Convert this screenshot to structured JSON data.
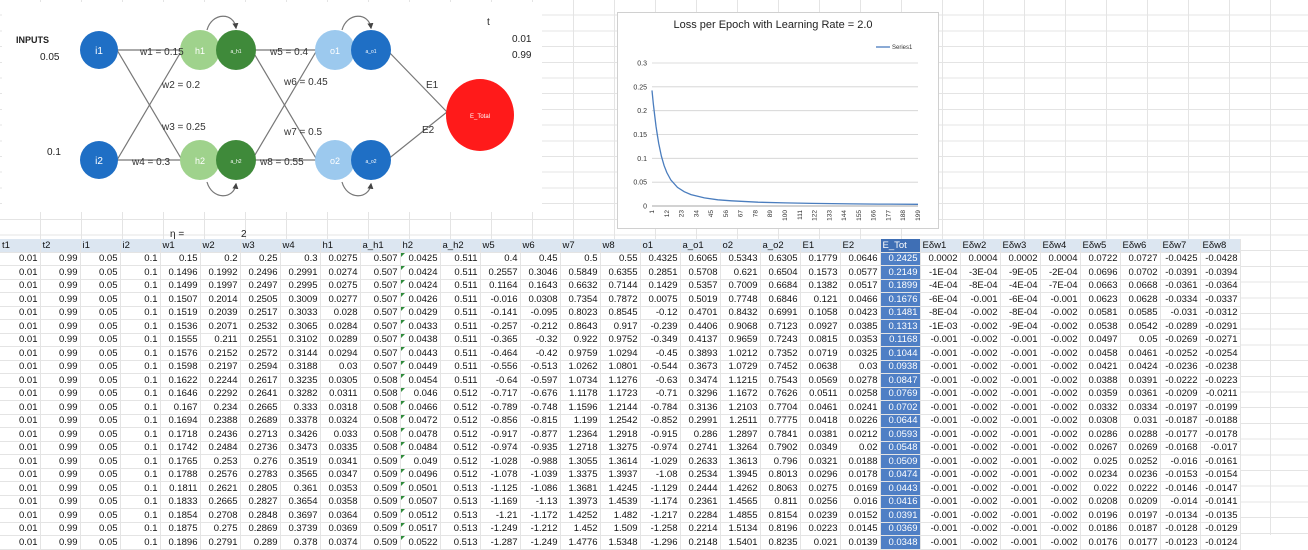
{
  "diagram": {
    "inputs_label": "INPUTS",
    "input1_value": "0.05",
    "input2_value": "0.1",
    "t_label": "t",
    "t1_value": "0.01",
    "t2_value": "0.99",
    "node_i1": "i1",
    "node_i2": "i2",
    "node_h1": "h1",
    "node_h2": "h2",
    "node_o1": "o1",
    "node_o2": "o2",
    "node_ah1": "a_h1",
    "node_ah2": "a_h2",
    "node_ao1": "a_o1",
    "node_ao2": "a_o2",
    "node_etotal": "E_Total",
    "w1": "w1 = 0.15",
    "w2": "w2 = 0.2",
    "w3": "w3 = 0.25",
    "w4": "w4 = 0.3",
    "w5": "w5 = 0.4",
    "w6": "w6 = 0.45",
    "w7": "w7 = 0.5",
    "w8": "w8 = 0.55",
    "e1": "E1",
    "e2": "E2",
    "colors": {
      "input": "#1f6fc5",
      "hidden_light": "#9fd28c",
      "hidden_dark": "#3f8a3a",
      "out_light": "#9cc9ee",
      "out_dark": "#1f6fc5",
      "etotal": "#ff1a1a"
    }
  },
  "eta": {
    "label": "η =",
    "value": "2"
  },
  "chart_data": {
    "type": "line",
    "title": "Loss per Epoch with Learning Rate = 2.0",
    "legend": [
      "Series1"
    ],
    "legend_position": "top-right",
    "ylim": [
      0,
      0.3
    ],
    "yticks": [
      "0",
      "0.05",
      "0.1",
      "0.15",
      "0.2",
      "0.25",
      "0.3"
    ],
    "xticks": [
      "1",
      "12",
      "23",
      "34",
      "45",
      "56",
      "67",
      "78",
      "89",
      "100",
      "111",
      "122",
      "133",
      "144",
      "155",
      "166",
      "177",
      "188",
      "199"
    ],
    "series": [
      {
        "name": "Series1",
        "x": [
          1,
          2,
          3,
          4,
          5,
          6,
          8,
          10,
          12,
          15,
          20,
          25,
          30,
          40,
          50,
          60,
          80,
          100,
          120,
          150,
          170,
          199
        ],
        "values": [
          0.2425,
          0.2149,
          0.1899,
          0.1676,
          0.1481,
          0.1313,
          0.1044,
          0.0847,
          0.0702,
          0.0548,
          0.0391,
          0.03,
          0.024,
          0.017,
          0.013,
          0.011,
          0.008,
          0.0065,
          0.0055,
          0.0045,
          0.004,
          0.0035
        ]
      }
    ],
    "grid": true,
    "color": "#4a7dbe"
  },
  "table": {
    "headers": [
      "t1",
      "t2",
      "i1",
      "i2",
      "w1",
      "w2",
      "w3",
      "w4",
      "h1",
      "a_h1",
      "h2",
      "a_h2",
      "w5",
      "w6",
      "w7",
      "w8",
      "o1",
      "a_o1",
      "o2",
      "a_o2",
      "E1",
      "E2",
      "E_Tot",
      "Eδw1",
      "Eδw2",
      "Eδw3",
      "Eδw4",
      "Eδw5",
      "Eδw6",
      "Eδw7",
      "Eδw8"
    ],
    "rows": [
      [
        "0.01",
        "0.99",
        "0.05",
        "0.1",
        "0.15",
        "0.2",
        "0.25",
        "0.3",
        "0.0275",
        "0.507",
        "0.0425",
        "0.511",
        "0.4",
        "0.45",
        "0.5",
        "0.55",
        "0.4325",
        "0.6065",
        "0.5343",
        "0.6305",
        "0.1779",
        "0.0646",
        "0.2425",
        "0.0002",
        "0.0004",
        "0.0002",
        "0.0004",
        "0.0722",
        "0.0727",
        "-0.0425",
        "-0.0428"
      ],
      [
        "0.01",
        "0.99",
        "0.05",
        "0.1",
        "0.1496",
        "0.1992",
        "0.2496",
        "0.2991",
        "0.0274",
        "0.507",
        "0.0424",
        "0.511",
        "0.2557",
        "0.3046",
        "0.5849",
        "0.6355",
        "0.2851",
        "0.5708",
        "0.621",
        "0.6504",
        "0.1573",
        "0.0577",
        "0.2149",
        "-1E-04",
        "-3E-04",
        "-9E-05",
        "-2E-04",
        "0.0696",
        "0.0702",
        "-0.0391",
        "-0.0394"
      ],
      [
        "0.01",
        "0.99",
        "0.05",
        "0.1",
        "0.1499",
        "0.1997",
        "0.2497",
        "0.2995",
        "0.0275",
        "0.507",
        "0.0424",
        "0.511",
        "0.1164",
        "0.1643",
        "0.6632",
        "0.7144",
        "0.1429",
        "0.5357",
        "0.7009",
        "0.6684",
        "0.1382",
        "0.0517",
        "0.1899",
        "-4E-04",
        "-8E-04",
        "-4E-04",
        "-7E-04",
        "0.0663",
        "0.0668",
        "-0.0361",
        "-0.0364"
      ],
      [
        "0.01",
        "0.99",
        "0.05",
        "0.1",
        "0.1507",
        "0.2014",
        "0.2505",
        "0.3009",
        "0.0277",
        "0.507",
        "0.0426",
        "0.511",
        "-0.016",
        "0.0308",
        "0.7354",
        "0.7872",
        "0.0075",
        "0.5019",
        "0.7748",
        "0.6846",
        "0.121",
        "0.0466",
        "0.1676",
        "-6E-04",
        "-0.001",
        "-6E-04",
        "-0.001",
        "0.0623",
        "0.0628",
        "-0.0334",
        "-0.0337"
      ],
      [
        "0.01",
        "0.99",
        "0.05",
        "0.1",
        "0.1519",
        "0.2039",
        "0.2517",
        "0.3033",
        "0.028",
        "0.507",
        "0.0429",
        "0.511",
        "-0.141",
        "-0.095",
        "0.8023",
        "0.8545",
        "-0.12",
        "0.4701",
        "0.8432",
        "0.6991",
        "0.1058",
        "0.0423",
        "0.1481",
        "-8E-04",
        "-0.002",
        "-8E-04",
        "-0.002",
        "0.0581",
        "0.0585",
        "-0.031",
        "-0.0312"
      ],
      [
        "0.01",
        "0.99",
        "0.05",
        "0.1",
        "0.1536",
        "0.2071",
        "0.2532",
        "0.3065",
        "0.0284",
        "0.507",
        "0.0433",
        "0.511",
        "-0.257",
        "-0.212",
        "0.8643",
        "0.917",
        "-0.239",
        "0.4406",
        "0.9068",
        "0.7123",
        "0.0927",
        "0.0385",
        "0.1313",
        "-1E-03",
        "-0.002",
        "-9E-04",
        "-0.002",
        "0.0538",
        "0.0542",
        "-0.0289",
        "-0.0291"
      ],
      [
        "0.01",
        "0.99",
        "0.05",
        "0.1",
        "0.1555",
        "0.211",
        "0.2551",
        "0.3102",
        "0.0289",
        "0.507",
        "0.0438",
        "0.511",
        "-0.365",
        "-0.32",
        "0.922",
        "0.9752",
        "-0.349",
        "0.4137",
        "0.9659",
        "0.7243",
        "0.0815",
        "0.0353",
        "0.1168",
        "-0.001",
        "-0.002",
        "-0.001",
        "-0.002",
        "0.0497",
        "0.05",
        "-0.0269",
        "-0.0271"
      ],
      [
        "0.01",
        "0.99",
        "0.05",
        "0.1",
        "0.1576",
        "0.2152",
        "0.2572",
        "0.3144",
        "0.0294",
        "0.507",
        "0.0443",
        "0.511",
        "-0.464",
        "-0.42",
        "0.9759",
        "1.0294",
        "-0.45",
        "0.3893",
        "1.0212",
        "0.7352",
        "0.0719",
        "0.0325",
        "0.1044",
        "-0.001",
        "-0.002",
        "-0.001",
        "-0.002",
        "0.0458",
        "0.0461",
        "-0.0252",
        "-0.0254"
      ],
      [
        "0.01",
        "0.99",
        "0.05",
        "0.1",
        "0.1598",
        "0.2197",
        "0.2594",
        "0.3188",
        "0.03",
        "0.507",
        "0.0449",
        "0.511",
        "-0.556",
        "-0.513",
        "1.0262",
        "1.0801",
        "-0.544",
        "0.3673",
        "1.0729",
        "0.7452",
        "0.0638",
        "0.03",
        "0.0938",
        "-0.001",
        "-0.002",
        "-0.001",
        "-0.002",
        "0.0421",
        "0.0424",
        "-0.0236",
        "-0.0238"
      ],
      [
        "0.01",
        "0.99",
        "0.05",
        "0.1",
        "0.1622",
        "0.2244",
        "0.2617",
        "0.3235",
        "0.0305",
        "0.508",
        "0.0454",
        "0.511",
        "-0.64",
        "-0.597",
        "1.0734",
        "1.1276",
        "-0.63",
        "0.3474",
        "1.1215",
        "0.7543",
        "0.0569",
        "0.0278",
        "0.0847",
        "-0.001",
        "-0.002",
        "-0.001",
        "-0.002",
        "0.0388",
        "0.0391",
        "-0.0222",
        "-0.0223"
      ],
      [
        "0.01",
        "0.99",
        "0.05",
        "0.1",
        "0.1646",
        "0.2292",
        "0.2641",
        "0.3282",
        "0.0311",
        "0.508",
        "0.046",
        "0.512",
        "-0.717",
        "-0.676",
        "1.1178",
        "1.1723",
        "-0.71",
        "0.3296",
        "1.1672",
        "0.7626",
        "0.0511",
        "0.0258",
        "0.0769",
        "-0.001",
        "-0.002",
        "-0.001",
        "-0.002",
        "0.0359",
        "0.0361",
        "-0.0209",
        "-0.0211"
      ],
      [
        "0.01",
        "0.99",
        "0.05",
        "0.1",
        "0.167",
        "0.234",
        "0.2665",
        "0.333",
        "0.0318",
        "0.508",
        "0.0466",
        "0.512",
        "-0.789",
        "-0.748",
        "1.1596",
        "1.2144",
        "-0.784",
        "0.3136",
        "1.2103",
        "0.7704",
        "0.0461",
        "0.0241",
        "0.0702",
        "-0.001",
        "-0.002",
        "-0.001",
        "-0.002",
        "0.0332",
        "0.0334",
        "-0.0197",
        "-0.0199"
      ],
      [
        "0.01",
        "0.99",
        "0.05",
        "0.1",
        "0.1694",
        "0.2388",
        "0.2689",
        "0.3378",
        "0.0324",
        "0.508",
        "0.0472",
        "0.512",
        "-0.856",
        "-0.815",
        "1.199",
        "1.2542",
        "-0.852",
        "0.2991",
        "1.2511",
        "0.7775",
        "0.0418",
        "0.0226",
        "0.0644",
        "-0.001",
        "-0.002",
        "-0.001",
        "-0.002",
        "0.0308",
        "0.031",
        "-0.0187",
        "-0.0188"
      ],
      [
        "0.01",
        "0.99",
        "0.05",
        "0.1",
        "0.1718",
        "0.2436",
        "0.2713",
        "0.3426",
        "0.033",
        "0.508",
        "0.0478",
        "0.512",
        "-0.917",
        "-0.877",
        "1.2364",
        "1.2918",
        "-0.915",
        "0.286",
        "1.2897",
        "0.7841",
        "0.0381",
        "0.0212",
        "0.0593",
        "-0.001",
        "-0.002",
        "-0.001",
        "-0.002",
        "0.0286",
        "0.0288",
        "-0.0177",
        "-0.0178"
      ],
      [
        "0.01",
        "0.99",
        "0.05",
        "0.1",
        "0.1742",
        "0.2484",
        "0.2736",
        "0.3473",
        "0.0335",
        "0.508",
        "0.0484",
        "0.512",
        "-0.974",
        "-0.935",
        "1.2718",
        "1.3275",
        "-0.974",
        "0.2741",
        "1.3264",
        "0.7902",
        "0.0349",
        "0.02",
        "0.0548",
        "-0.001",
        "-0.002",
        "-0.001",
        "-0.002",
        "0.0267",
        "0.0269",
        "-0.0168",
        "-0.017"
      ],
      [
        "0.01",
        "0.99",
        "0.05",
        "0.1",
        "0.1765",
        "0.253",
        "0.276",
        "0.3519",
        "0.0341",
        "0.509",
        "0.049",
        "0.512",
        "-1.028",
        "-0.988",
        "1.3055",
        "1.3614",
        "-1.029",
        "0.2633",
        "1.3613",
        "0.796",
        "0.0321",
        "0.0188",
        "0.0509",
        "-0.001",
        "-0.002",
        "-0.001",
        "-0.002",
        "0.025",
        "0.0252",
        "-0.016",
        "-0.0161"
      ],
      [
        "0.01",
        "0.99",
        "0.05",
        "0.1",
        "0.1788",
        "0.2576",
        "0.2783",
        "0.3565",
        "0.0347",
        "0.509",
        "0.0496",
        "0.512",
        "-1.078",
        "-1.039",
        "1.3375",
        "1.3937",
        "-1.08",
        "0.2534",
        "1.3945",
        "0.8013",
        "0.0296",
        "0.0178",
        "0.0474",
        "-0.001",
        "-0.002",
        "-0.001",
        "-0.002",
        "0.0234",
        "0.0236",
        "-0.0153",
        "-0.0154"
      ],
      [
        "0.01",
        "0.99",
        "0.05",
        "0.1",
        "0.1811",
        "0.2621",
        "0.2805",
        "0.361",
        "0.0353",
        "0.509",
        "0.0501",
        "0.513",
        "-1.125",
        "-1.086",
        "1.3681",
        "1.4245",
        "-1.129",
        "0.2444",
        "1.4262",
        "0.8063",
        "0.0275",
        "0.0169",
        "0.0443",
        "-0.001",
        "-0.002",
        "-0.001",
        "-0.002",
        "0.022",
        "0.0222",
        "-0.0146",
        "-0.0147"
      ],
      [
        "0.01",
        "0.99",
        "0.05",
        "0.1",
        "0.1833",
        "0.2665",
        "0.2827",
        "0.3654",
        "0.0358",
        "0.509",
        "0.0507",
        "0.513",
        "-1.169",
        "-1.13",
        "1.3973",
        "1.4539",
        "-1.174",
        "0.2361",
        "1.4565",
        "0.811",
        "0.0256",
        "0.016",
        "0.0416",
        "-0.001",
        "-0.002",
        "-0.001",
        "-0.002",
        "0.0208",
        "0.0209",
        "-0.014",
        "-0.0141"
      ],
      [
        "0.01",
        "0.99",
        "0.05",
        "0.1",
        "0.1854",
        "0.2708",
        "0.2848",
        "0.3697",
        "0.0364",
        "0.509",
        "0.0512",
        "0.513",
        "-1.21",
        "-1.172",
        "1.4252",
        "1.482",
        "-1.217",
        "0.2284",
        "1.4855",
        "0.8154",
        "0.0239",
        "0.0152",
        "0.0391",
        "-0.001",
        "-0.002",
        "-0.001",
        "-0.002",
        "0.0196",
        "0.0197",
        "-0.0134",
        "-0.0135"
      ],
      [
        "0.01",
        "0.99",
        "0.05",
        "0.1",
        "0.1875",
        "0.275",
        "0.2869",
        "0.3739",
        "0.0369",
        "0.509",
        "0.0517",
        "0.513",
        "-1.249",
        "-1.212",
        "1.452",
        "1.509",
        "-1.258",
        "0.2214",
        "1.5134",
        "0.8196",
        "0.0223",
        "0.0145",
        "0.0369",
        "-0.001",
        "-0.002",
        "-0.001",
        "-0.002",
        "0.0186",
        "0.0187",
        "-0.0128",
        "-0.0129"
      ],
      [
        "0.01",
        "0.99",
        "0.05",
        "0.1",
        "0.1896",
        "0.2791",
        "0.289",
        "0.378",
        "0.0374",
        "0.509",
        "0.0522",
        "0.513",
        "-1.287",
        "-1.249",
        "1.4776",
        "1.5348",
        "-1.296",
        "0.2148",
        "1.5401",
        "0.8235",
        "0.021",
        "0.0139",
        "0.0348",
        "-0.001",
        "-0.002",
        "-0.001",
        "-0.002",
        "0.0176",
        "0.0177",
        "-0.0123",
        "-0.0124"
      ]
    ]
  }
}
